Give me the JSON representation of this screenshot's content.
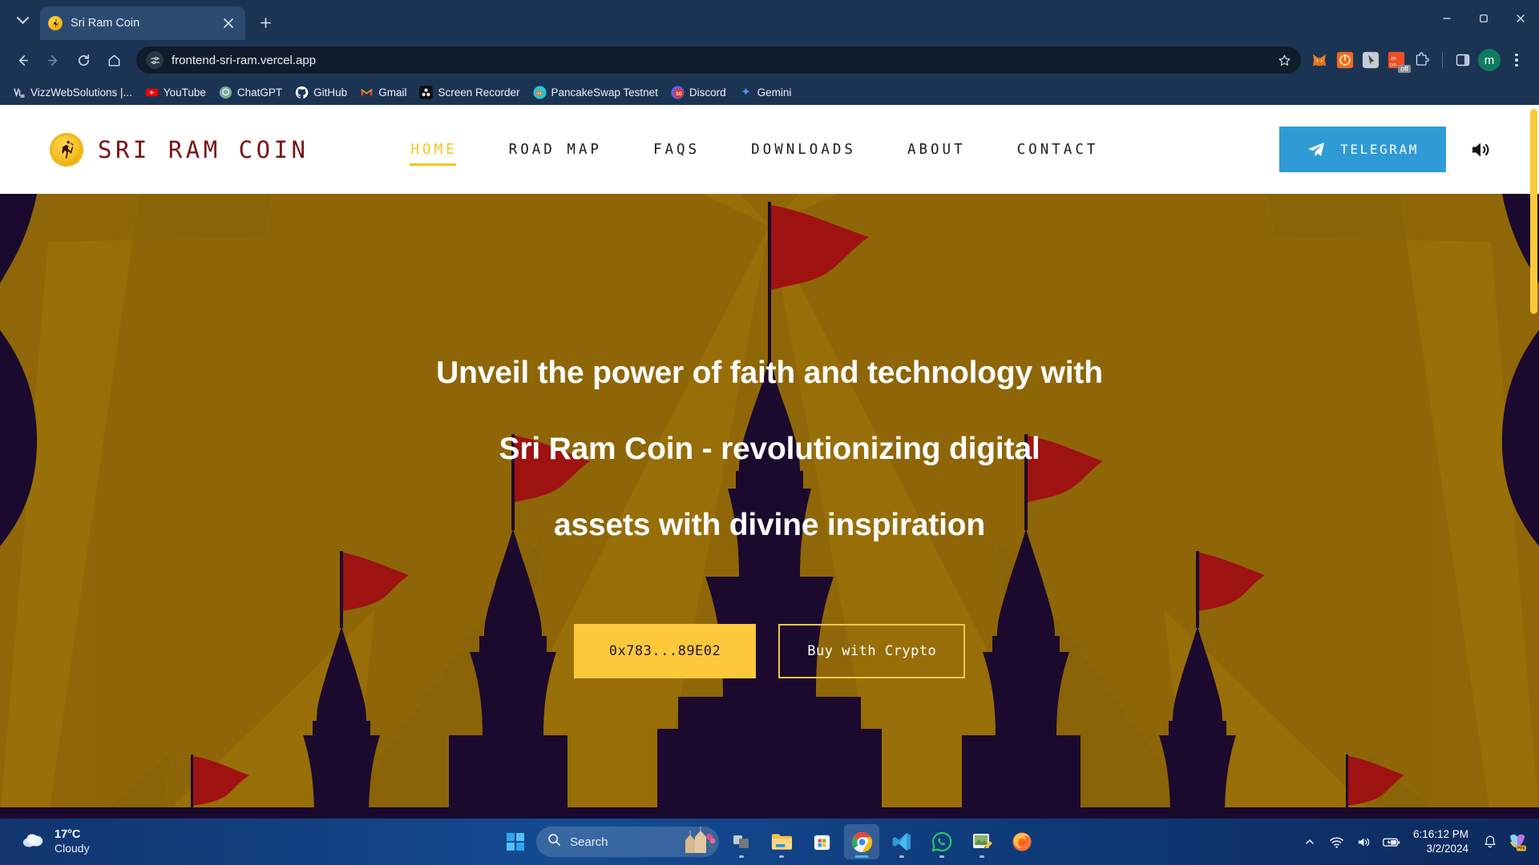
{
  "browser": {
    "tab": {
      "title": "Sri Ram Coin",
      "favicon_icon": "sri-ram-coin-favicon"
    },
    "new_tab_label": "+",
    "tab_search_icon": "chevron-down-icon",
    "window_controls": {
      "minimize": "minimize-icon",
      "maximize": "maximize-icon",
      "close": "close-icon"
    },
    "nav": {
      "back_icon": "back-arrow-icon",
      "forward_icon": "forward-arrow-icon",
      "reload_icon": "reload-icon",
      "home_icon": "home-icon"
    },
    "omnibox": {
      "url": "frontend-sri-ram.vercel.app",
      "site_info_icon": "site-settings-icon",
      "bookmark_icon": "star-icon"
    },
    "extensions": [
      {
        "name": "metamask-extension-icon"
      },
      {
        "name": "orange-circle-extension-icon"
      },
      {
        "name": "cursor-extension-icon"
      },
      {
        "name": "off-badge-extension-icon",
        "badge": "off"
      },
      {
        "name": "extensions-puzzle-icon"
      },
      {
        "name": "side-panel-icon"
      }
    ],
    "profile_initial": "m",
    "menu_icon": "three-dot-menu-icon",
    "bookmarks": [
      {
        "label": "VizzWebSolutions |...",
        "icon": "vizzweb-icon"
      },
      {
        "label": "YouTube",
        "icon": "youtube-icon"
      },
      {
        "label": "ChatGPT",
        "icon": "chatgpt-icon"
      },
      {
        "label": "GitHub",
        "icon": "github-icon"
      },
      {
        "label": "Gmail",
        "icon": "gmail-icon"
      },
      {
        "label": "Screen Recorder",
        "icon": "screen-recorder-icon"
      },
      {
        "label": "PancakeSwap Testnet",
        "icon": "pancakeswap-icon"
      },
      {
        "label": "Discord",
        "icon": "discord-icon",
        "badge": "10"
      },
      {
        "label": "Gemini",
        "icon": "gemini-icon"
      }
    ]
  },
  "site": {
    "logo": {
      "text": "SRI RAM COIN",
      "icon": "sri-ram-coin-logo"
    },
    "nav_items": [
      {
        "label": "HOME",
        "active": true
      },
      {
        "label": "ROAD MAP",
        "active": false
      },
      {
        "label": "FAQS",
        "active": false
      },
      {
        "label": "DOWNLOADS",
        "active": false
      },
      {
        "label": "ABOUT",
        "active": false
      },
      {
        "label": "CONTACT",
        "active": false
      }
    ],
    "telegram_button": {
      "label": "TELEGRAM",
      "icon": "telegram-paper-plane-icon"
    },
    "sound_icon": "speaker-volume-icon",
    "hero": {
      "line1": "Unveil the power of faith and technology with",
      "line2": "Sri Ram Coin - revolutionizing digital",
      "line3": "assets with divine inspiration",
      "primary_button": "0x783...89E02",
      "secondary_button": "Buy with Crypto"
    },
    "colors": {
      "accent_yellow": "#f5c518",
      "button_yellow": "#fdc93b",
      "logo_maroon": "#7a1414",
      "telegram_blue": "#2e9bd6",
      "hero_gold": "#8f6708",
      "temple_navy": "#1b0a2e"
    }
  },
  "taskbar": {
    "weather": {
      "temperature": "17°C",
      "condition": "Cloudy",
      "icon": "cloudy-icon"
    },
    "start_icon": "windows-start-icon",
    "search": {
      "placeholder": "Search",
      "icon": "search-icon"
    },
    "apps": [
      {
        "name": "task-view-icon",
        "running": true,
        "active": false
      },
      {
        "name": "file-explorer-icon",
        "running": true,
        "active": false
      },
      {
        "name": "microsoft-store-icon",
        "running": false,
        "active": false
      },
      {
        "name": "google-chrome-icon",
        "running": true,
        "active": true
      },
      {
        "name": "vs-code-icon",
        "running": true,
        "active": false
      },
      {
        "name": "whatsapp-icon",
        "running": true,
        "active": false
      },
      {
        "name": "paint-icon",
        "running": true,
        "active": false
      },
      {
        "name": "firefox-icon",
        "running": false,
        "active": false
      }
    ],
    "tray": [
      {
        "name": "show-hidden-icons-chevron"
      },
      {
        "name": "wifi-icon"
      },
      {
        "name": "volume-icon"
      },
      {
        "name": "battery-charging-icon"
      }
    ],
    "clock": {
      "time": "6:16:12 PM",
      "date": "3/2/2024"
    },
    "notification_icon": "bell-icon",
    "copilot_icon": "copilot-pre-icon"
  }
}
